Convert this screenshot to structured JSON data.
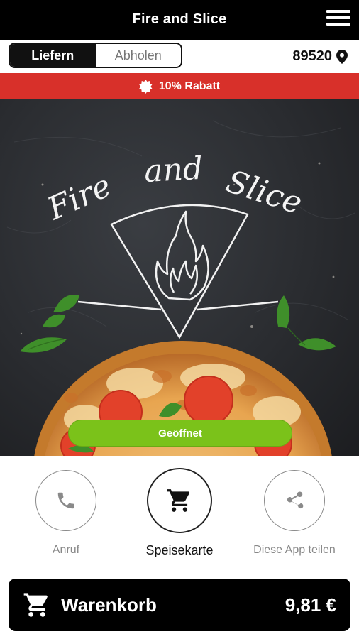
{
  "header": {
    "title": "Fire and Slice",
    "menu_icon": "hamburger-menu-icon"
  },
  "mode_toggle": {
    "options": [
      "Liefern",
      "Abholen"
    ],
    "selected": "Liefern"
  },
  "location": {
    "zip": "89520",
    "icon": "location-pin-icon"
  },
  "promo": {
    "text": "10% Rabatt",
    "icon": "discount-badge-icon"
  },
  "hero": {
    "logo_text": "Fire and Slice",
    "status_button": "Geöffnet",
    "status_color": "#7bc21a"
  },
  "actions": [
    {
      "label": "Anruf",
      "icon": "phone-icon"
    },
    {
      "label": "Speisekarte",
      "icon": "shopping-cart-icon"
    },
    {
      "label": "Diese App teilen",
      "icon": "share-icon"
    }
  ],
  "cart": {
    "label": "Warenkorb",
    "total": "9,81 €",
    "icon": "shopping-cart-icon"
  },
  "colors": {
    "accent_red": "#d8302a",
    "open_green": "#7bc21a",
    "bar_black": "#000000"
  }
}
